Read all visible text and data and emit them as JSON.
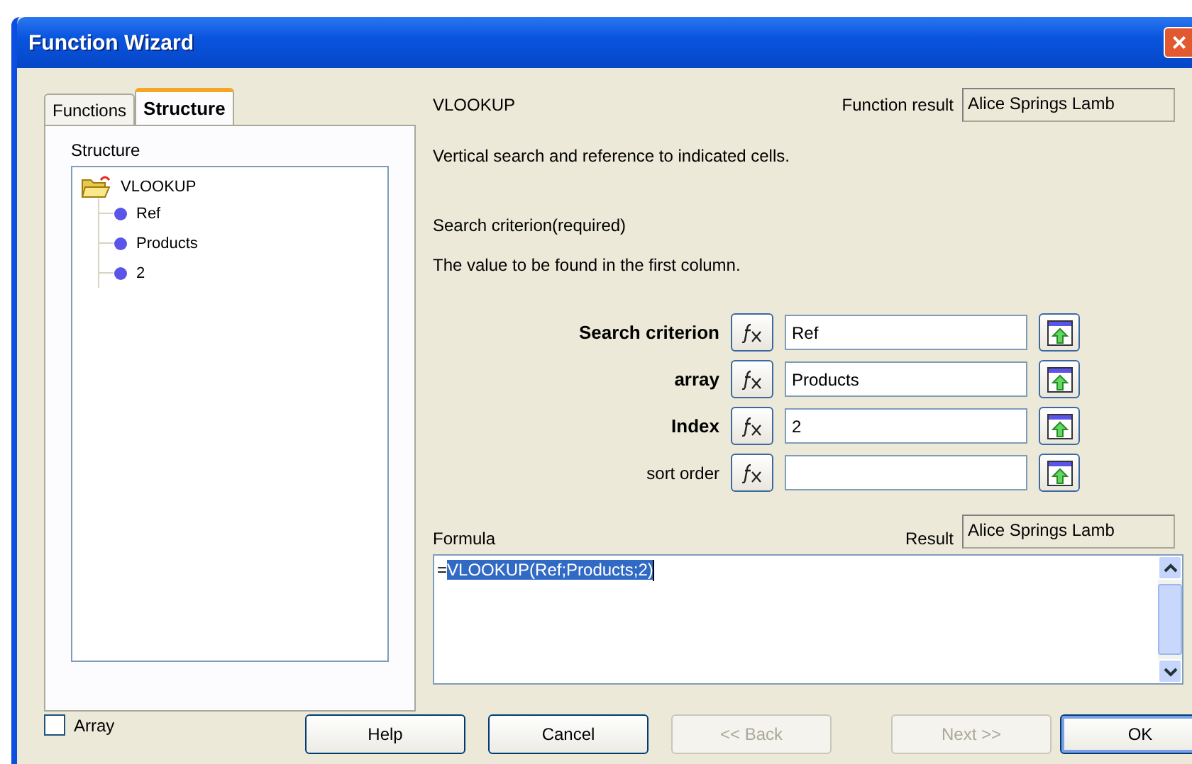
{
  "window": {
    "title": "Function Wizard",
    "close": "×"
  },
  "tabs": [
    {
      "label": "Functions",
      "selected": false
    },
    {
      "label": "Structure",
      "selected": true
    }
  ],
  "structure": {
    "label": "Structure",
    "tree": [
      {
        "label": "VLOOKUP",
        "kind": "function",
        "expanded": true,
        "children": [
          {
            "label": "Ref",
            "kind": "argument"
          },
          {
            "label": "Products",
            "kind": "argument"
          },
          {
            "label": "2",
            "kind": "argument"
          }
        ]
      }
    ]
  },
  "function_name": "VLOOKUP",
  "function_result": {
    "label": "Function result",
    "value": "Alice Springs Lamb"
  },
  "description": "Vertical search and reference to indicated cells.",
  "argument_title": "Search criterion(required)",
  "argument_description": "The value to be found in the first column.",
  "arguments": [
    {
      "label": "Search criterion",
      "required": true,
      "value": "Ref"
    },
    {
      "label": "array",
      "required": true,
      "value": "Products"
    },
    {
      "label": "Index",
      "required": true,
      "value": "2"
    },
    {
      "label": "sort order",
      "required": false
    }
  ],
  "formula": {
    "label": "Formula",
    "prefix": "=",
    "selected_text": "VLOOKUP(Ref;Products;2)"
  },
  "result": {
    "label": "Result",
    "value": "Alice Springs Lamb"
  },
  "array_checkbox": {
    "label": "Array",
    "checked": false
  },
  "buttons": [
    {
      "label": "Help",
      "disabled": false,
      "default": false
    },
    {
      "label": "Cancel",
      "disabled": false,
      "default": false
    },
    {
      "label": "<< Back",
      "disabled": true,
      "default": false
    },
    {
      "label": "Next >>",
      "disabled": true,
      "default": false
    },
    {
      "label": "OK",
      "disabled": false,
      "default": true
    }
  ]
}
